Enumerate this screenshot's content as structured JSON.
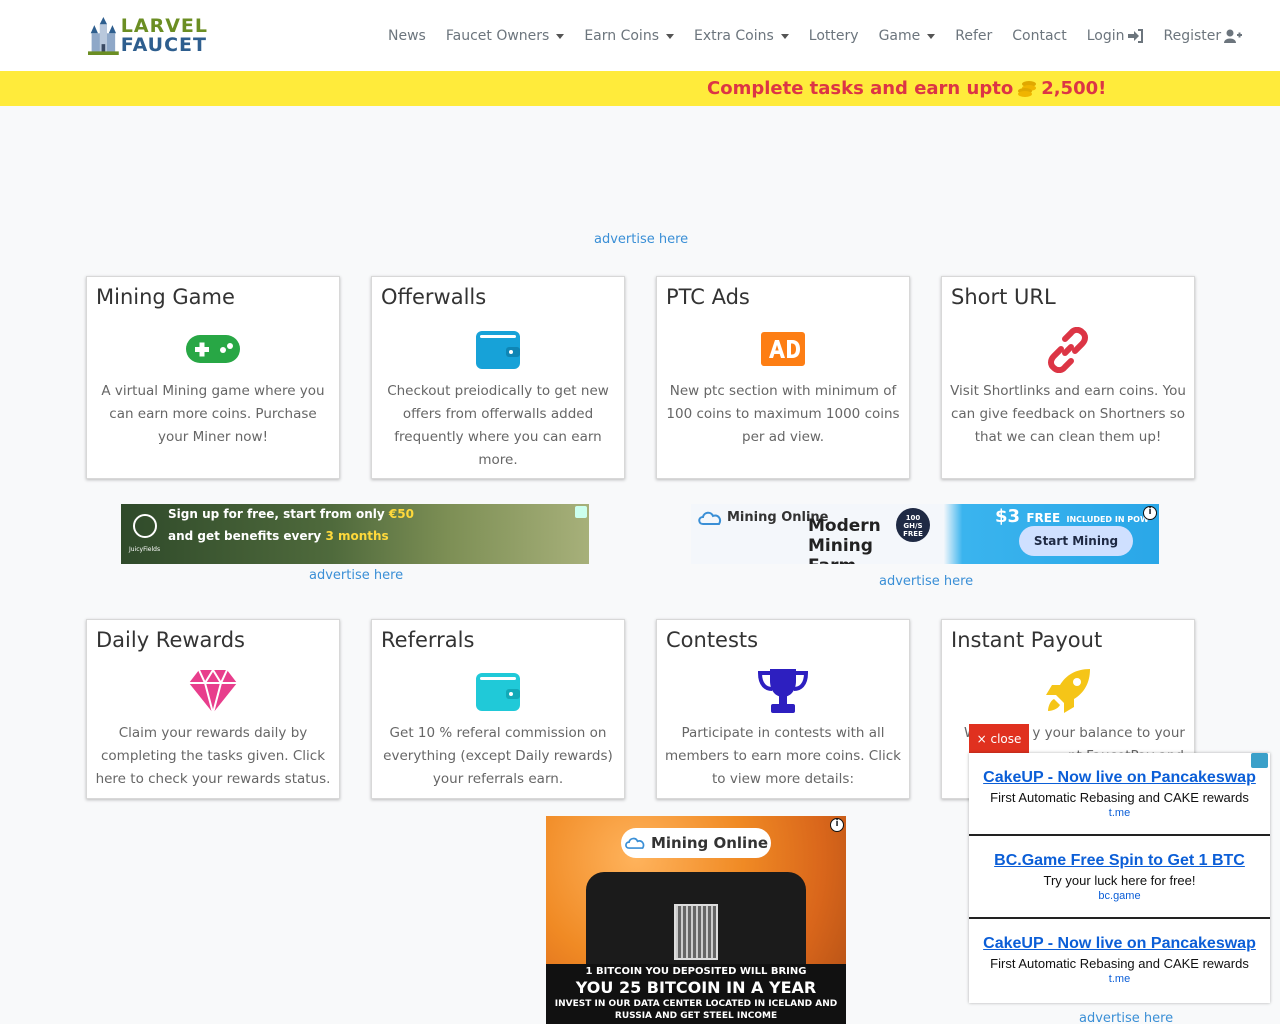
{
  "nav": {
    "brand_line1": "LARVEL",
    "brand_line2": "FAUCET",
    "items": [
      {
        "label": "News",
        "dropdown": false
      },
      {
        "label": "Faucet Owners",
        "dropdown": true
      },
      {
        "label": "Earn Coins",
        "dropdown": true
      },
      {
        "label": "Extra Coins",
        "dropdown": true
      },
      {
        "label": "Lottery",
        "dropdown": false
      },
      {
        "label": "Game",
        "dropdown": true
      },
      {
        "label": "Refer",
        "dropdown": false
      },
      {
        "label": "Contact",
        "dropdown": false
      }
    ],
    "login": "Login",
    "register": "Register"
  },
  "banner": {
    "text_before": "Complete tasks and earn upto",
    "text_after": "2,500!",
    "color": "#ffeb3b",
    "text_color": "#dc3545"
  },
  "advertise": "advertise here",
  "cards_row1": [
    {
      "title": "Mining Game",
      "icon": "gamepad-icon",
      "text": "A virtual Mining game where you can earn more coins. Purchase your Miner now!"
    },
    {
      "title": "Offerwalls",
      "icon": "wallet-icon",
      "text": "Checkout preiodically to get new offers from offerwalls added frequently where you can earn more."
    },
    {
      "title": "PTC Ads",
      "icon": "ad-icon",
      "text": "New ptc section with minimum of 100 coins to maximum 1000 coins per ad view."
    },
    {
      "title": "Short URL",
      "icon": "link-icon",
      "text": "Visit Shortlinks and earn coins. You can give feedback on Shortners so that we can clean them up!"
    }
  ],
  "cards_row2": [
    {
      "title": "Daily Rewards",
      "icon": "gem-icon",
      "text": "Claim your rewards daily by completing the tasks given. Click here to check your rewards status."
    },
    {
      "title": "Referrals",
      "icon": "wallet-icon",
      "text": "Get 10 % referal commission on everything (except Daily rewards) your referrals earn."
    },
    {
      "title": "Contests",
      "icon": "trophy-icon",
      "text": "Participate in contests with all members to earn more coins. Click to view more details:"
    },
    {
      "title": "Instant Payout",
      "icon": "rocket-icon",
      "text_visible_1": "W",
      "text_visible_2": "y your balance to your",
      "text_visible_3": "nt FaucetPay and"
    }
  ],
  "icon_colors": {
    "gamepad": "#28a745",
    "wallet": "#17a2d8",
    "ad": "#fd7e14",
    "link": "#dc3545",
    "gem": "#e83e8c",
    "referral_wallet": "#20c9d8",
    "trophy": "#2d1fc0",
    "rocket": "#f5c518"
  },
  "ads": {
    "cannabis_line1": "Sign up for free, start from only",
    "cannabis_hl1": "€50",
    "cannabis_line2": "and get benefits every",
    "cannabis_hl2": "3 months",
    "cannabis_brand": "JuicyFields",
    "mining_logo": "Mining Online",
    "mining_big": "Modern Mining Farm",
    "mining_badge": "100 GH/S FREE",
    "mining_free": "$3",
    "mining_free_word": "FREE",
    "mining_included": "INCLUDED IN POW",
    "mining_button": "Start Mining",
    "rolls_logo": "Mining Online",
    "rolls_t1": "1 BITCOIN YOU DEPOSITED WILL BRING",
    "rolls_t2": "YOU 25 BITCOIN IN A YEAR",
    "rolls_t3": "INVEST IN OUR DATA CENTER LOCATED IN ICELAND AND RUSSIA AND GET STEEL INCOME"
  },
  "float_ad": {
    "close": "× close",
    "items": [
      {
        "title": "CakeUP - Now live on Pancakeswap",
        "desc": "First Automatic Rebasing and CAKE rewards",
        "src": "t.me"
      },
      {
        "title": "BC.Game Free Spin to Get 1 BTC",
        "desc": "Try your luck here for free!",
        "src": "bc.game"
      },
      {
        "title": "CakeUP - Now live on Pancakeswap",
        "desc": "First Automatic Rebasing and CAKE rewards",
        "src": "t.me"
      }
    ]
  }
}
